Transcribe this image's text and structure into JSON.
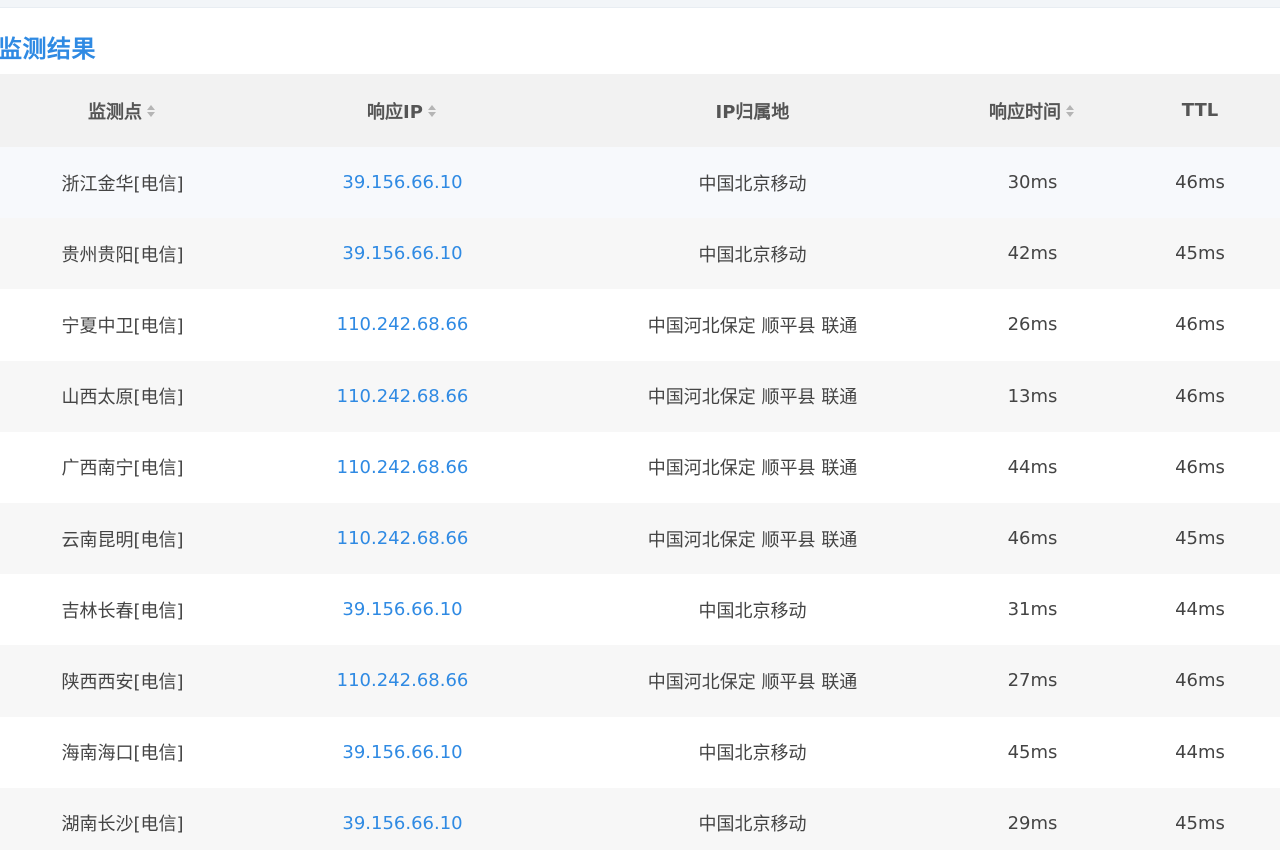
{
  "section": {
    "title": "监测结果"
  },
  "table": {
    "columns": [
      {
        "label": "监测点",
        "sortable": true
      },
      {
        "label": "响应IP",
        "sortable": true
      },
      {
        "label": "IP归属地",
        "sortable": false
      },
      {
        "label": "响应时间",
        "sortable": true
      },
      {
        "label": "TTL",
        "sortable": false
      }
    ],
    "rows": [
      {
        "node": "浙江金华[电信]",
        "ip": "39.156.66.10",
        "location": "中国北京移动",
        "time": "30ms",
        "ttl": "46ms"
      },
      {
        "node": "贵州贵阳[电信]",
        "ip": "39.156.66.10",
        "location": "中国北京移动",
        "time": "42ms",
        "ttl": "45ms"
      },
      {
        "node": "宁夏中卫[电信]",
        "ip": "110.242.68.66",
        "location": "中国河北保定 顺平县 联通",
        "time": "26ms",
        "ttl": "46ms"
      },
      {
        "node": "山西太原[电信]",
        "ip": "110.242.68.66",
        "location": "中国河北保定 顺平县 联通",
        "time": "13ms",
        "ttl": "46ms"
      },
      {
        "node": "广西南宁[电信]",
        "ip": "110.242.68.66",
        "location": "中国河北保定 顺平县 联通",
        "time": "44ms",
        "ttl": "46ms"
      },
      {
        "node": "云南昆明[电信]",
        "ip": "110.242.68.66",
        "location": "中国河北保定 顺平县 联通",
        "time": "46ms",
        "ttl": "45ms"
      },
      {
        "node": "吉林长春[电信]",
        "ip": "39.156.66.10",
        "location": "中国北京移动",
        "time": "31ms",
        "ttl": "44ms"
      },
      {
        "node": "陕西西安[电信]",
        "ip": "110.242.68.66",
        "location": "中国河北保定 顺平县 联通",
        "time": "27ms",
        "ttl": "46ms"
      },
      {
        "node": "海南海口[电信]",
        "ip": "39.156.66.10",
        "location": "中国北京移动",
        "time": "45ms",
        "ttl": "44ms"
      },
      {
        "node": "湖南长沙[电信]",
        "ip": "39.156.66.10",
        "location": "中国北京移动",
        "time": "29ms",
        "ttl": "45ms"
      }
    ]
  },
  "colors": {
    "accent": "#2f8ae3",
    "header_bg": "#f2f2f2",
    "row_alt_bg": "#f7f7f7",
    "text": "#444444"
  },
  "icons": {
    "sort": "sort-caret-icon"
  }
}
